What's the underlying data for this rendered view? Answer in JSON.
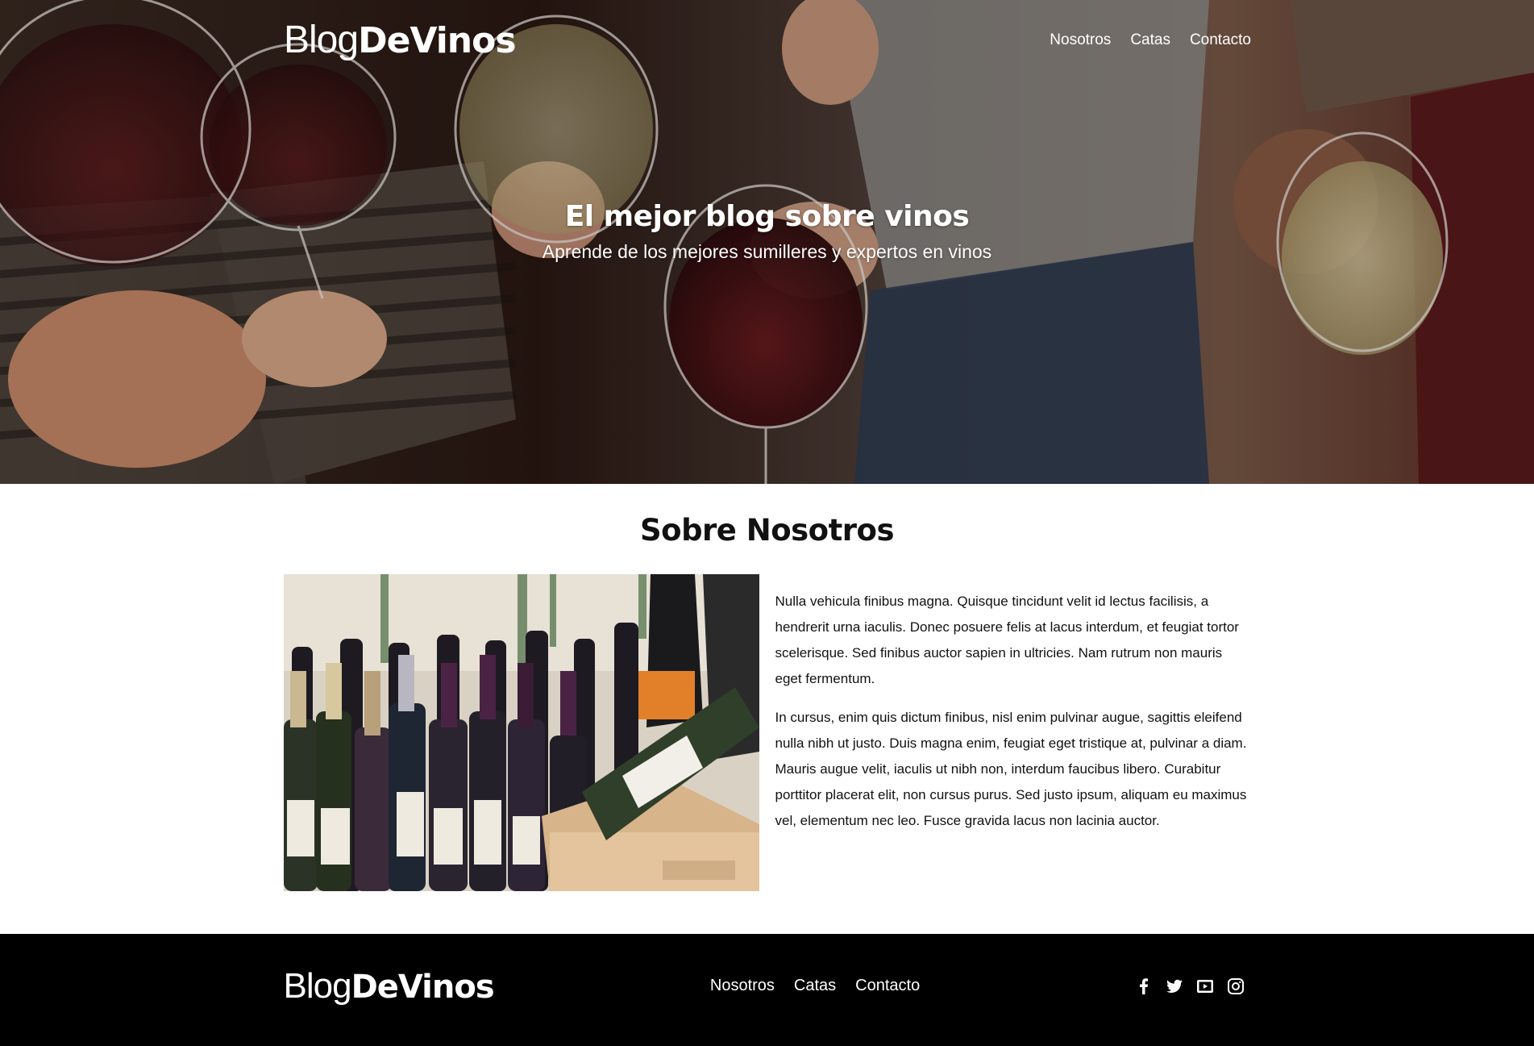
{
  "header": {
    "logo_light": "Blog",
    "logo_bold": "DeVinos",
    "nav": [
      {
        "label": "Nosotros"
      },
      {
        "label": "Catas"
      },
      {
        "label": "Contacto"
      }
    ]
  },
  "hero": {
    "title": "El mejor blog sobre vinos",
    "subtitle": "Aprende de los mejores sumilleres y expertos en vinos"
  },
  "about": {
    "title": "Sobre Nosotros",
    "paragraphs": [
      "Nulla vehicula finibus magna. Quisque tincidunt velit id lectus facilisis, a hendrerit urna iaculis. Donec posuere felis at lacus interdum, et feugiat tortor scelerisque. Sed finibus auctor sapien in ultricies. Nam rutrum non mauris eget fermentum.",
      "In cursus, enim quis dictum finibus, nisl enim pulvinar augue, sagittis eleifend nulla nibh ut justo. Duis magna enim, feugiat eget tristique at, pulvinar a diam. Mauris augue velit, iaculis ut nibh non, interdum faucibus libero. Curabitur porttitor placerat elit, non cursus purus. Sed justo ipsum, aliquam eu maximus vel, elementum nec leo. Fusce gravida lacus non lacinia auctor."
    ]
  },
  "footer": {
    "logo_light": "Blog",
    "logo_bold": "DeVinos",
    "nav": [
      {
        "label": "Nosotros"
      },
      {
        "label": "Catas"
      },
      {
        "label": "Contacto"
      }
    ],
    "social_icons": [
      "facebook-icon",
      "twitter-icon",
      "youtube-icon",
      "instagram-icon"
    ]
  },
  "colors": {
    "footer_bg": "#000000",
    "text": "#111111",
    "hero_text": "#ffffff"
  }
}
